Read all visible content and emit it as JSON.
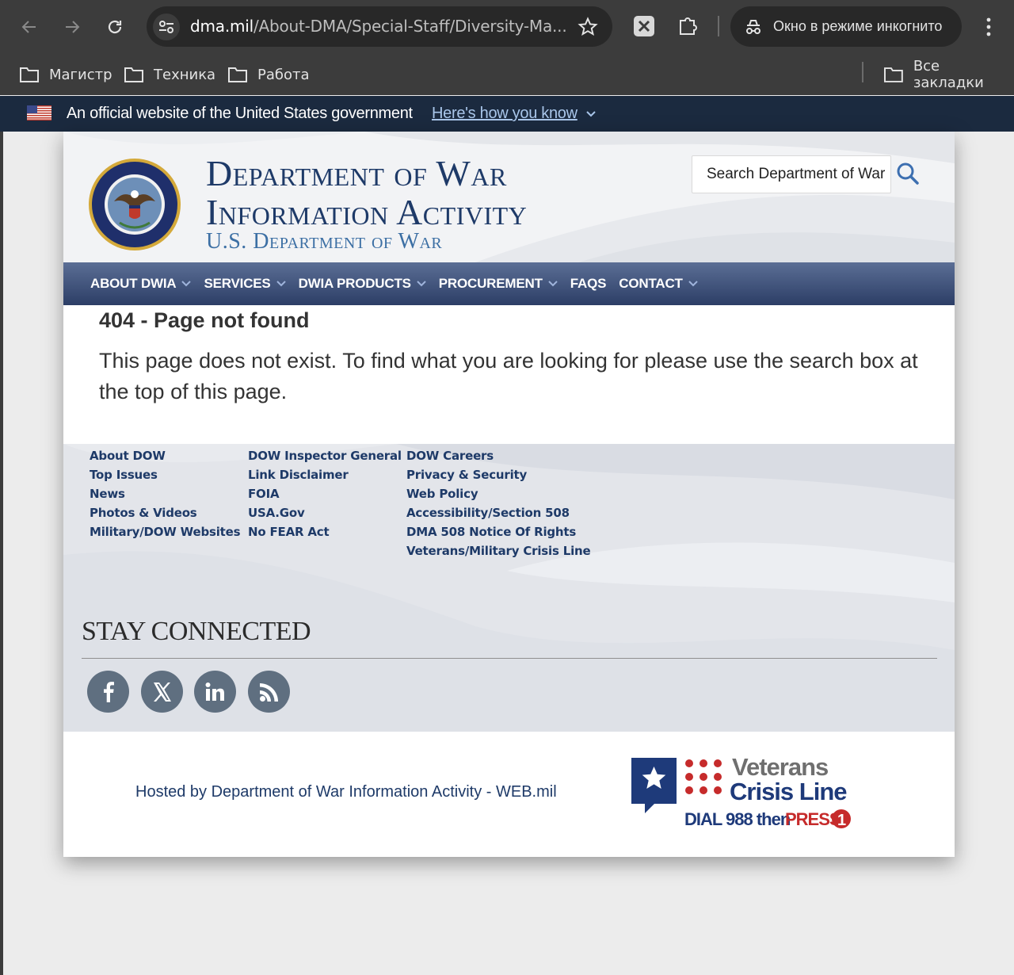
{
  "browser": {
    "url_host": "dma.mil",
    "url_path": "/About-DMA/Special-Staff/Diversity-Ma...",
    "incognito_label": "Окно в режиме инкогнито",
    "bookmarks": [
      "Магистр",
      "Техника",
      "Работа"
    ],
    "all_bookmarks": "Все закладки",
    "icons": [
      "back-arrow-icon",
      "forward-arrow-icon",
      "reload-icon",
      "site-info-icon",
      "star-icon",
      "extension-icon",
      "puzzle-icon",
      "incognito-icon",
      "more-menu-icon",
      "folder-icon"
    ]
  },
  "gov_banner": {
    "text": "An official website of the United States government",
    "link": "Here's how you know"
  },
  "header": {
    "title_line1": "Department of War",
    "title_line2": "Information Activity",
    "subtitle": "U.S. Department of War",
    "search_placeholder": "Search Department of War"
  },
  "nav": {
    "items": [
      {
        "label": "ABOUT DWIA"
      },
      {
        "label": "SERVICES"
      },
      {
        "label": "DWIA PRODUCTS"
      },
      {
        "label": "PROCUREMENT"
      },
      {
        "label": "FAQS"
      },
      {
        "label": "CONTACT"
      }
    ]
  },
  "content": {
    "title": "404 - Page not found",
    "body": "This page does not exist. To find what you are looking for please use the search box at the top of this page."
  },
  "footer": {
    "col1": [
      "About DOW",
      "Top Issues",
      "News",
      "Photos & Videos",
      "Military/DOW Websites"
    ],
    "col2": [
      "DOW Inspector General",
      "Link Disclaimer",
      "FOIA",
      "USA.Gov",
      "No FEAR Act"
    ],
    "col3": [
      "DOW Careers",
      "Privacy & Security",
      "Web Policy",
      "Accessibility/Section 508",
      "DMA 508 Notice Of Rights",
      "Veterans/Military Crisis Line"
    ],
    "stay_connected": "STAY CONNECTED",
    "social": [
      "facebook-icon",
      "x-icon",
      "linkedin-icon",
      "rss-icon"
    ],
    "hosted_by": "Hosted by Department of War Information Activity - WEB.mil",
    "vcl": {
      "line1": "Veterans",
      "line2": "Crisis Line",
      "dial": "DIAL 988 then",
      "press": "PRESS",
      "num": "1"
    }
  },
  "colors": {
    "navy": "#1e3a68",
    "link_blue": "#a9c6ea",
    "banner": "#1b2a3f",
    "vcl_red": "#c62b2b"
  }
}
